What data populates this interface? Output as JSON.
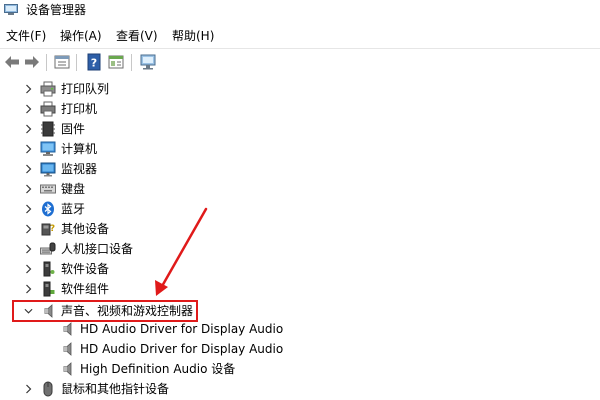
{
  "window": {
    "title": "设备管理器",
    "accent": "#e01a1a"
  },
  "menubar": {
    "items": [
      "文件(F)",
      "操作(A)",
      "查看(V)",
      "帮助(H)"
    ]
  },
  "toolbar": {
    "buttons": [
      "back-arrow-icon",
      "forward-arrow-icon",
      "properties-icon",
      "help-icon",
      "show-hide-icon",
      "monitor-scan-icon"
    ]
  },
  "tree": {
    "rows": [
      {
        "label": "打印队列",
        "icon": "print-queue-icon",
        "expanded": false
      },
      {
        "label": "打印机",
        "icon": "printer-icon",
        "expanded": false
      },
      {
        "label": "固件",
        "icon": "firmware-icon",
        "expanded": false
      },
      {
        "label": "计算机",
        "icon": "computer-icon",
        "expanded": false
      },
      {
        "label": "监视器",
        "icon": "monitor-icon",
        "expanded": false
      },
      {
        "label": "键盘",
        "icon": "keyboard-icon",
        "expanded": false
      },
      {
        "label": "蓝牙",
        "icon": "bluetooth-icon",
        "expanded": false
      },
      {
        "label": "其他设备",
        "icon": "unknown-device-icon",
        "expanded": false
      },
      {
        "label": "人机接口设备",
        "icon": "hid-icon",
        "expanded": false
      },
      {
        "label": "软件设备",
        "icon": "software-device-icon",
        "expanded": false
      },
      {
        "label": "软件组件",
        "icon": "software-component-icon",
        "expanded": false
      },
      {
        "label": "声音、视频和游戏控制器",
        "icon": "speaker-icon",
        "expanded": true
      },
      {
        "label": "HD Audio Driver for Display Audio",
        "icon": "speaker-icon",
        "child": true
      },
      {
        "label": "HD Audio Driver for Display Audio",
        "icon": "speaker-icon",
        "child": true
      },
      {
        "label": "High Definition Audio 设备",
        "icon": "speaker-icon",
        "child": true
      },
      {
        "label": "鼠标和其他指针设备",
        "icon": "mouse-icon",
        "expanded": false
      }
    ]
  }
}
